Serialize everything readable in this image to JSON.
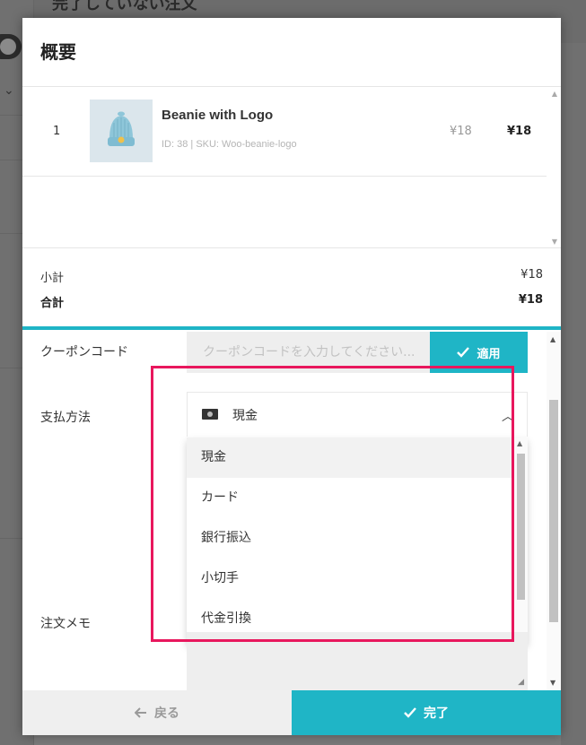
{
  "background": {
    "title": "完了していない注文"
  },
  "modal": {
    "title": "概要"
  },
  "items": [
    {
      "index": "1",
      "name": "Beanie with Logo",
      "meta": "ID: 38 | SKU: Woo-beanie-logo",
      "unit_price": "¥18",
      "total": "¥18"
    }
  ],
  "totals": {
    "subtotal_label": "小計",
    "subtotal_value": "¥18",
    "total_label": "合計",
    "total_value": "¥18"
  },
  "coupon": {
    "label": "クーポンコード",
    "placeholder": "クーポンコードを入力してください...",
    "apply_label": "適用"
  },
  "payment": {
    "label": "支払方法",
    "selected": "現金",
    "options": [
      "現金",
      "カード",
      "銀行振込",
      "小切手",
      "代金引換"
    ]
  },
  "note": {
    "label": "注文メモ"
  },
  "footer": {
    "back_label": "戻る",
    "done_label": "完了"
  },
  "colors": {
    "accent": "#1fb5c6",
    "highlight": "#e8175d"
  }
}
